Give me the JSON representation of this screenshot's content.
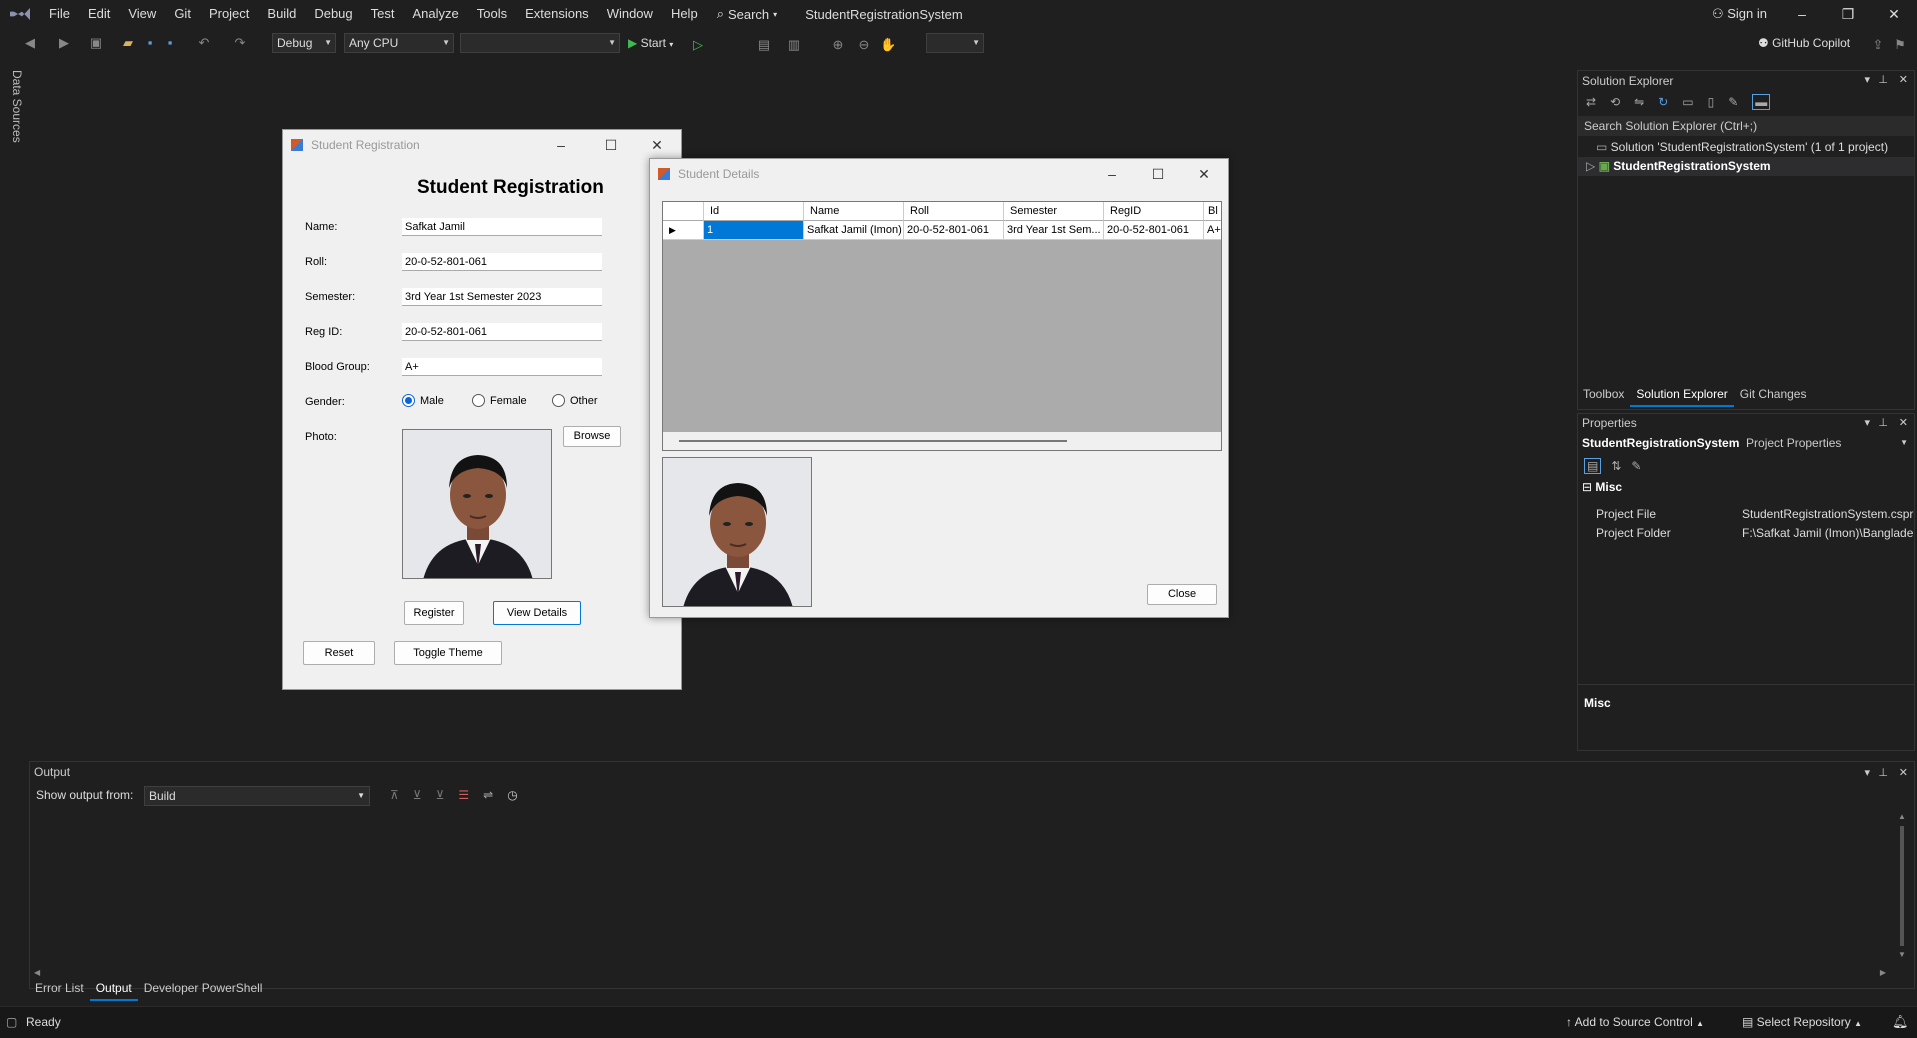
{
  "menubar": {
    "items": [
      "File",
      "Edit",
      "View",
      "Git",
      "Project",
      "Build",
      "Debug",
      "Test",
      "Analyze",
      "Tools",
      "Extensions",
      "Window",
      "Help"
    ],
    "search_label": "Search",
    "solution_name": "StudentRegistrationSystem",
    "sign_in": "Sign in"
  },
  "toolbar": {
    "config": "Debug",
    "platform": "Any CPU",
    "start_label": "Start",
    "copilot_label": "GitHub Copilot"
  },
  "side_tab": "Data Sources",
  "solution_explorer": {
    "title": "Solution Explorer",
    "search_placeholder": "Search Solution Explorer (Ctrl+;)",
    "solution_node": "Solution 'StudentRegistrationSystem' (1 of 1 project)",
    "project_node": "StudentRegistrationSystem",
    "tabs": [
      "Toolbox",
      "Solution Explorer",
      "Git Changes"
    ]
  },
  "properties": {
    "title": "Properties",
    "object_name": "StudentRegistrationSystem",
    "object_type": "Project Properties",
    "category": "Misc",
    "rows": [
      {
        "name": "Project File",
        "value": "StudentRegistrationSystem.cspr"
      },
      {
        "name": "Project Folder",
        "value": "F:\\Safkat Jamil (Imon)\\Banglade"
      }
    ],
    "description_title": "Misc"
  },
  "registration_form": {
    "window_title": "Student Registration",
    "heading": "Student Registration",
    "labels": {
      "name": "Name:",
      "roll": "Roll:",
      "semester": "Semester:",
      "regid": "Reg ID:",
      "blood": "Blood Group:",
      "gender": "Gender:",
      "photo": "Photo:"
    },
    "values": {
      "name": "Safkat Jamil",
      "roll": "20-0-52-801-061",
      "semester": "3rd Year 1st Semester 2023",
      "regid": "20-0-52-801-061",
      "blood": "A+"
    },
    "gender_options": [
      "Male",
      "Female",
      "Other"
    ],
    "gender_selected": "Male",
    "buttons": {
      "browse": "Browse",
      "register": "Register",
      "view_details": "View Details",
      "reset": "Reset",
      "toggle_theme": "Toggle Theme"
    }
  },
  "details_form": {
    "window_title": "Student Details",
    "columns": [
      "Id",
      "Name",
      "Roll",
      "Semester",
      "RegID",
      "Bl"
    ],
    "rows": [
      [
        "1",
        "Safkat Jamil (Imon)",
        "20-0-52-801-061",
        "3rd Year 1st Sem...",
        "20-0-52-801-061",
        "A+"
      ]
    ],
    "close_label": "Close"
  },
  "output": {
    "title": "Output",
    "show_from_label": "Show output from:",
    "source": "Build",
    "tabs": [
      "Error List",
      "Output",
      "Developer PowerShell"
    ]
  },
  "statusbar": {
    "status": "Ready",
    "source_control": "Add to Source Control",
    "repository": "Select Repository"
  },
  "colors": {
    "accent": "#0078d4",
    "selection": "#0078d7",
    "ide_bg": "#1f1f1f"
  }
}
